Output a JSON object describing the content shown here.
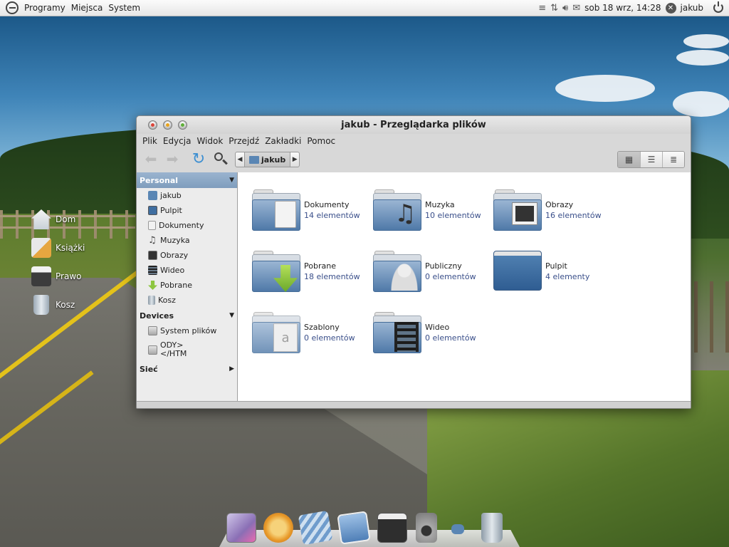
{
  "top_panel": {
    "menus": [
      "Programy",
      "Miejsca",
      "System"
    ],
    "clock": "sob 18 wrz, 14:28",
    "user": "jakub"
  },
  "desktop_icons": [
    {
      "label": "Dom",
      "icon": "home-icon",
      "color": "#d8dfe6"
    },
    {
      "label": "Książki",
      "icon": "books-rss-icon",
      "color": "#e6a640"
    },
    {
      "label": "Prawo",
      "icon": "typewriter-icon",
      "color": "#3c3c3c"
    },
    {
      "label": "Kosz",
      "icon": "trash-icon",
      "color": "#c7d2dc"
    }
  ],
  "window": {
    "title": "jakub - Przeglądarka plików",
    "menu": [
      "Plik",
      "Edycja",
      "Widok",
      "Przejdź",
      "Zakładki",
      "Pomoc"
    ],
    "path": "jakub",
    "sidebar": {
      "personal_header": "Personal",
      "personal": [
        {
          "label": "jakub",
          "icon": "home-folder-icon",
          "color": "#5a86b4"
        },
        {
          "label": "Pulpit",
          "icon": "desktop-icon",
          "color": "#3f6ea0"
        },
        {
          "label": "Dokumenty",
          "icon": "document-icon",
          "color": "#f2f2f2"
        },
        {
          "label": "Muzyka",
          "icon": "music-note-icon",
          "color": "#555555"
        },
        {
          "label": "Obrazy",
          "icon": "picture-icon",
          "color": "#333333"
        },
        {
          "label": "Wideo",
          "icon": "film-icon",
          "color": "#4a5a6a"
        },
        {
          "label": "Pobrane",
          "icon": "download-arrow-icon",
          "color": "#8dc63f"
        },
        {
          "label": "Kosz",
          "icon": "trash-icon",
          "color": "#aab8c4"
        }
      ],
      "devices_header": "Devices",
      "devices": [
        {
          "label": "System plików",
          "icon": "harddisk-icon",
          "color": "#bbbbbb"
        },
        {
          "label_line1": "ODY>",
          "label_line2": "</HTM",
          "icon": "harddisk-icon",
          "color": "#bbbbbb"
        }
      ],
      "network_header": "Sieć"
    },
    "files": [
      {
        "name": "Dokumenty",
        "count": "14 elementów",
        "emblem": "document-emblem-icon"
      },
      {
        "name": "Muzyka",
        "count": "10 elementów",
        "emblem": "music-emblem-icon"
      },
      {
        "name": "Obrazy",
        "count": "16 elementów",
        "emblem": "picture-emblem-icon"
      },
      {
        "name": "Pobrane",
        "count": "18 elementów",
        "emblem": "download-emblem-icon"
      },
      {
        "name": "Publiczny",
        "count": "0 elementów",
        "emblem": "person-emblem-icon"
      },
      {
        "name": "Pulpit",
        "count": "4 elementy",
        "emblem": "desktop-emblem-icon"
      },
      {
        "name": "Szablony",
        "count": "0 elementów",
        "emblem": "template-emblem-icon"
      },
      {
        "name": "Wideo",
        "count": "0 elementów",
        "emblem": "film-emblem-icon"
      }
    ]
  },
  "dock": [
    {
      "icon": "photo-app-icon",
      "color": "#8a6fb5"
    },
    {
      "icon": "compass-browser-icon",
      "color": "#e89a2a"
    },
    {
      "icon": "mail-stamp-icon",
      "color": "#6f9ccc"
    },
    {
      "icon": "photo-viewer-icon",
      "color": "#4f7fb7"
    },
    {
      "icon": "clapperboard-icon",
      "color": "#2e2e2e"
    },
    {
      "icon": "speaker-icon",
      "color": "#9a9a9a"
    },
    {
      "icon": "folder-small-icon",
      "color": "#5a86b4"
    },
    {
      "icon": "trash-icon",
      "color": "#aebcc8"
    }
  ]
}
